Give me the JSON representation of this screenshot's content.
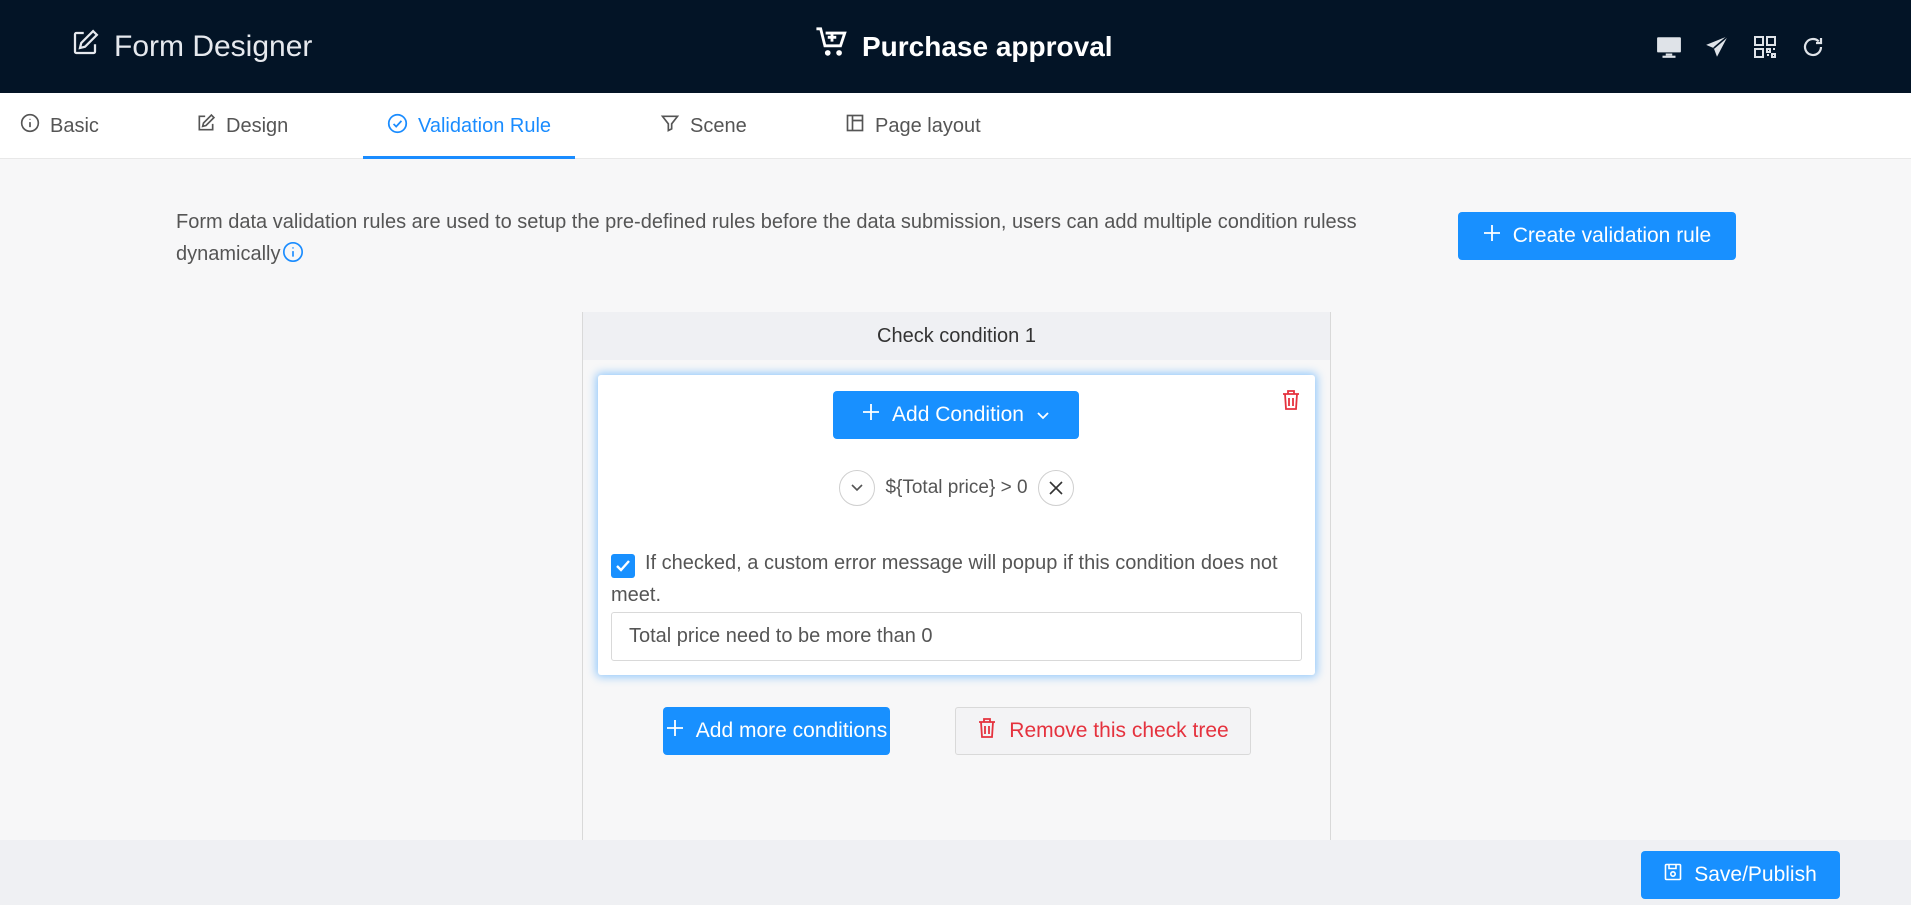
{
  "header": {
    "brand_icon": "edit-icon",
    "brand_label": "Form Designer",
    "title_icon": "cart-plus-icon",
    "title": "Purchase approval",
    "tools": [
      "desktop-icon",
      "send-icon",
      "qrcode-icon",
      "refresh-icon"
    ]
  },
  "tabs": [
    {
      "label": "Basic",
      "icon": "info-circle-icon"
    },
    {
      "label": "Design",
      "icon": "edit-icon"
    },
    {
      "label": "Validation Rule",
      "icon": "check-circle-icon",
      "active": true
    },
    {
      "label": "Scene",
      "icon": "filter-icon"
    },
    {
      "label": "Page layout",
      "icon": "layout-icon"
    }
  ],
  "validation": {
    "description": "Form data validation rules are used to setup the pre-defined rules before the data submission, users can add multiple condition ruless dynamically",
    "create_label": "Create validation rule",
    "check_title": "Check condition 1",
    "add_condition_label": "Add Condition",
    "condition_expr": "${Total price} > 0",
    "custom_msg_checked": true,
    "custom_msg_label": "If checked, a custom error message will popup if this condition does not meet.",
    "custom_msg_value": "Total price need to be more than 0",
    "add_more_label": "Add more conditions",
    "remove_label": "Remove this check tree"
  },
  "footer": {
    "save_label": "Save/Publish"
  },
  "colors": {
    "header_bg": "#031426",
    "primary": "#1890ff",
    "danger": "#e5323e"
  }
}
